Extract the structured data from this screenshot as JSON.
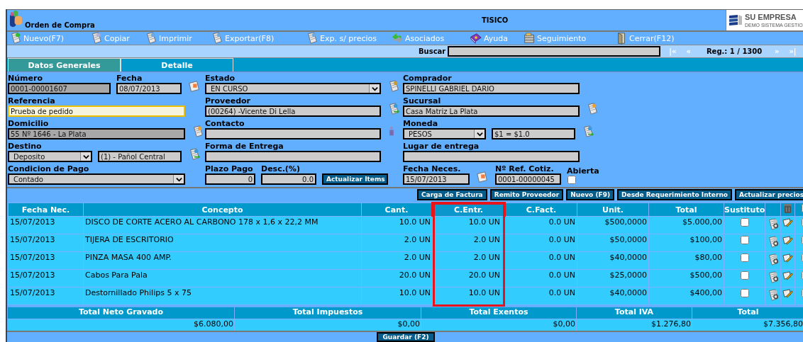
{
  "header": {
    "title": "Orden de Compra",
    "center_text": "TISICO",
    "brand": {
      "name": "SU EMPRESA",
      "tagline": "DEMO SISTEMA GESTIO"
    }
  },
  "toolbar": [
    {
      "label": "Nuevo(F7)",
      "kind": "new"
    },
    {
      "label": "Copiar",
      "kind": "copy"
    },
    {
      "label": "Imprimir",
      "kind": "print"
    },
    {
      "label": "Exportar(F8)",
      "kind": "print"
    },
    {
      "label": "Exp. s/ precios",
      "kind": "print"
    },
    {
      "label": "Asociados",
      "kind": "linked"
    },
    {
      "label": "Ayuda",
      "kind": "help"
    },
    {
      "label": "Seguimiento",
      "kind": "tracking"
    },
    {
      "label": "Cerrar(F12)",
      "kind": "close"
    }
  ],
  "search": {
    "label": "Buscar"
  },
  "pager": {
    "first": "|«",
    "prev": "«",
    "record": "Reg.: 1 / 1300",
    "next": "»",
    "last": "»|"
  },
  "tabs": [
    {
      "label": "Datos Generales",
      "selected": true
    },
    {
      "label": "Detalle",
      "selected": false
    }
  ],
  "form": [
    [
      [
        {
          "kind": "text",
          "label": "Número",
          "value": "0001-00001607",
          "locked": true,
          "focused": false
        },
        {
          "kind": "text",
          "label": "Fecha",
          "value": "08/07/2013",
          "locked": false,
          "focused": false
        },
        {
          "kind": "calendar"
        }
      ],
      [
        {
          "kind": "select",
          "label": "Estado",
          "value": "EN CURSO"
        },
        {
          "kind": "gear"
        }
      ],
      [
        {
          "kind": "text",
          "label": "Comprador",
          "value": "SPINELLI GABRIEL DARIO",
          "locked": false,
          "focused": false
        }
      ]
    ],
    [
      [
        {
          "kind": "text",
          "label": "Referencia",
          "value": "Prueba de pedido",
          "locked": false,
          "focused": true
        }
      ],
      [
        {
          "kind": "text",
          "label": "Proveedor",
          "value": "(00264) -Vicente Di Lella",
          "locked": false,
          "focused": false
        },
        {
          "kind": "lookup"
        }
      ],
      [
        {
          "kind": "text",
          "label": "Sucursal",
          "value": "Casa Matriz La Plata",
          "locked": false,
          "focused": false
        },
        {
          "kind": "edit"
        }
      ]
    ],
    [
      [
        {
          "kind": "text",
          "label": "Domicilio",
          "value": "55 Nº 1646 - La Plata",
          "locked": true,
          "focused": false
        },
        {
          "kind": "edit"
        }
      ],
      [
        {
          "kind": "text",
          "label": "Contacto",
          "locked": false,
          "focused": false
        },
        {
          "kind": "contact"
        }
      ],
      [
        {
          "kind": "select",
          "label": "Moneda",
          "value": "PESOS"
        },
        {
          "kind": "text",
          "value": "$1 = $1.0",
          "locked": false,
          "focused": false
        },
        {
          "kind": "lookup"
        }
      ]
    ],
    [
      [
        {
          "kind": "select",
          "label": "Destino",
          "value": "Deposito"
        },
        {
          "kind": "text",
          "value": "(1) - Pañol Central",
          "locked": false,
          "focused": false
        },
        {
          "kind": "lookup"
        }
      ],
      [
        {
          "kind": "text",
          "label": "Forma de Entrega",
          "locked": false,
          "focused": false
        }
      ],
      [
        {
          "kind": "text",
          "label": "Lugar de entrega",
          "locked": false,
          "focused": false
        }
      ]
    ],
    [
      [
        {
          "kind": "select",
          "label": "Condicion de Pago",
          "value": "Contado"
        }
      ],
      [
        {
          "kind": "number",
          "label": "Plazo Pago",
          "value": "0",
          "locked": false,
          "focused": false
        },
        {
          "kind": "number",
          "label": "Desc.(%)",
          "value": "0.0",
          "locked": false,
          "focused": false
        },
        {
          "kind": "button",
          "label": "Actualizar Items"
        }
      ],
      [
        {
          "kind": "text",
          "label": "Fecha Neces.",
          "value": "15/07/2013",
          "locked": false,
          "focused": false
        },
        {
          "kind": "calendar"
        },
        {
          "kind": "text",
          "label": "Nº Ref. Cotiz.",
          "value": "0001-00000045",
          "locked": false,
          "focused": false
        },
        {
          "kind": "checkbox",
          "label": "Abierta",
          "checked": false
        }
      ]
    ]
  ],
  "actions": [
    "Carga de Factura",
    "Remito Proveedor",
    "Nuevo (F9)",
    "Desde Requerimiento Interno",
    "Actualizar precios"
  ],
  "table": {
    "columns": [
      {
        "label": "Fecha Nec.",
        "highlighted": false
      },
      {
        "label": "Concepto",
        "highlighted": false
      },
      {
        "label": "Cant.",
        "highlighted": false
      },
      {
        "label": "C.Entr.",
        "highlighted": true
      },
      {
        "label": "C.Fact.",
        "highlighted": false
      },
      {
        "label": "Unit.",
        "highlighted": false
      },
      {
        "label": "Total",
        "highlighted": false
      },
      {
        "label": "Sustituto",
        "highlighted": false
      }
    ],
    "select_all": false,
    "rows": [
      {
        "cells": [
          "15/07/2013",
          "DISCO DE CORTE ACERO AL CARBONO 178 x 1,6 x 22,2 MM",
          "10.0 UN",
          "10.0 UN",
          "0.0 UN",
          "$500,0000",
          "$5.000,00"
        ],
        "sustituto": false,
        "checked": false
      },
      {
        "cells": [
          "15/07/2013",
          "TIJERA DE ESCRITORIO",
          "2.0 UN",
          "2.0 UN",
          "0.0 UN",
          "$50,0000",
          "$100,00"
        ],
        "sustituto": false,
        "checked": false
      },
      {
        "cells": [
          "15/07/2013",
          "PINZA MASA 400 AMP.",
          "2.0 UN",
          "2.0 UN",
          "0.0 UN",
          "$40,0000",
          "$80,00"
        ],
        "sustituto": false,
        "checked": false
      },
      {
        "cells": [
          "15/07/2013",
          "Cabos Para Pala",
          "20.0 UN",
          "20.0 UN",
          "0.0 UN",
          "$25,0000",
          "$500,00"
        ],
        "sustituto": false,
        "checked": false
      },
      {
        "cells": [
          "15/07/2013",
          "Destornillado Philips 5 x 75",
          "10.0 UN",
          "10.0 UN",
          "0.0 UN",
          "$40,0000",
          "$400,00"
        ],
        "sustituto": false,
        "checked": false
      }
    ]
  },
  "totals": [
    {
      "label": "Total Neto Gravado",
      "value": "$6.080,00"
    },
    {
      "label": "Total Impuestos",
      "value": "$0,00"
    },
    {
      "label": "Total Exentos",
      "value": "$0,00"
    },
    {
      "label": "Total IVA",
      "value": "$1.276,80"
    },
    {
      "label": "Total",
      "value": "$7.356,80"
    }
  ],
  "footer": {
    "button": "Guardar (F2)"
  }
}
